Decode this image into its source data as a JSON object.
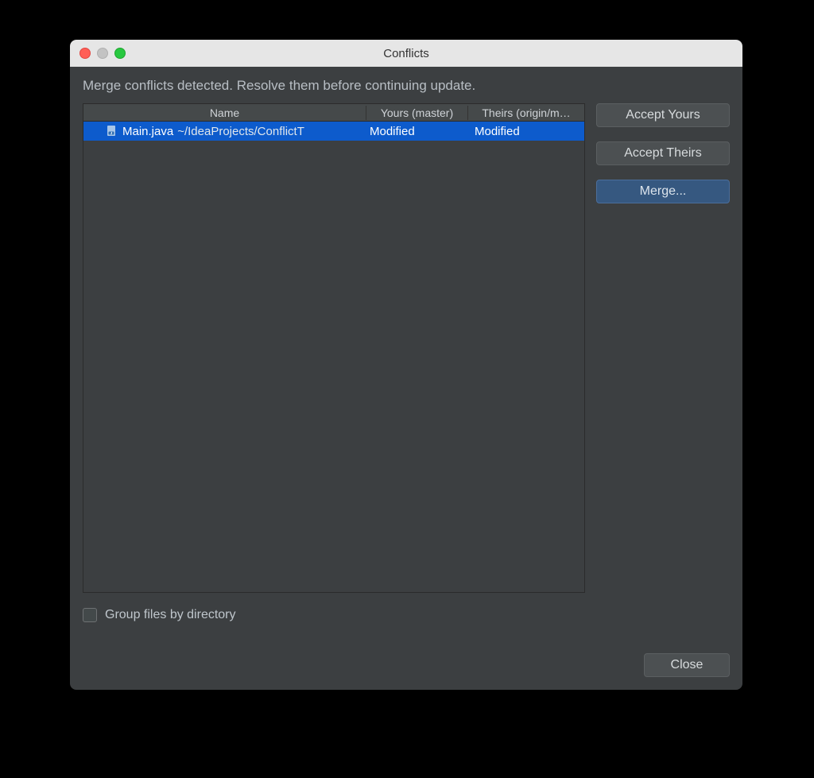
{
  "window": {
    "title": "Conflicts"
  },
  "message": "Merge conflicts detected. Resolve them before continuing update.",
  "table": {
    "columns": {
      "name": "Name",
      "yours": "Yours (master)",
      "theirs": "Theirs (origin/m…"
    },
    "rows": [
      {
        "filename": "Main.java",
        "path": "~/IdeaProjects/ConflictT",
        "yours": "Modified",
        "theirs": "Modified",
        "selected": true
      }
    ]
  },
  "buttons": {
    "accept_yours": "Accept Yours",
    "accept_theirs": "Accept Theirs",
    "merge": "Merge...",
    "close": "Close"
  },
  "checkbox": {
    "group_files": "Group files by directory",
    "checked": false
  }
}
